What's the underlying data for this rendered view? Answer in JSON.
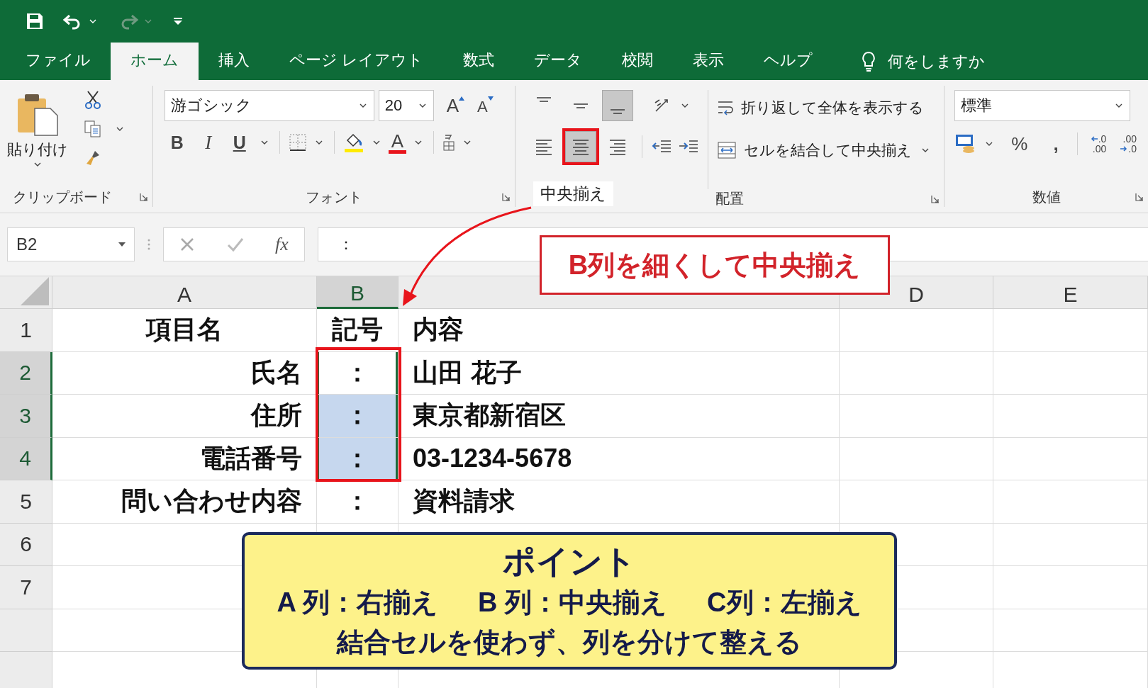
{
  "quick_access": [
    {
      "kind": "save",
      "disabled": false
    },
    {
      "kind": "undo",
      "disabled": false
    },
    {
      "kind": "redo",
      "disabled": true
    },
    {
      "kind": "customize",
      "disabled": false
    }
  ],
  "tabs": [
    {
      "label": "ファイル",
      "selected": false
    },
    {
      "label": "ホーム",
      "selected": true
    },
    {
      "label": "挿入",
      "selected": false
    },
    {
      "label": "ページ レイアウト",
      "selected": false
    },
    {
      "label": "数式",
      "selected": false
    },
    {
      "label": "データ",
      "selected": false
    },
    {
      "label": "校閲",
      "selected": false
    },
    {
      "label": "表示",
      "selected": false
    },
    {
      "label": "ヘルプ",
      "selected": false
    }
  ],
  "tell_me": "何をしますか",
  "clipboard": {
    "paste_label": "貼り付け",
    "title": "クリップボード"
  },
  "font": {
    "font_name": "游ゴシック",
    "font_size": "20",
    "grow_letter": "A",
    "shrink_letter": "A",
    "style_buttons": [
      "B",
      "I",
      "U"
    ],
    "font_color_letter": "A",
    "title": "フォント"
  },
  "alignment": {
    "buttons": [
      {
        "kind": "top",
        "selected": false,
        "annotated": false
      },
      {
        "kind": "middle",
        "selected": false,
        "annotated": false
      },
      {
        "kind": "bottom",
        "selected": true,
        "annotated": false
      },
      {
        "kind": "left",
        "selected": false,
        "annotated": false
      },
      {
        "kind": "center",
        "selected": true,
        "annotated": true
      },
      {
        "kind": "right",
        "selected": false,
        "annotated": false
      }
    ],
    "wrap_text": "折り返して全体を表示する",
    "merge_center": "セルを結合して中央揃え",
    "title": "配置"
  },
  "number": {
    "format": "標準",
    "percent": "%",
    "comma": ",",
    "increase_decimal": {
      "top": ".0",
      "bottom": ".00"
    },
    "decrease_decimal": {
      "top": ".00",
      "bottom": ".0"
    },
    "title": "数値"
  },
  "formula_bar": {
    "name_box": "B2",
    "fx": "fx",
    "content": "："
  },
  "sheet": {
    "columns": [
      {
        "label": "A",
        "selected": false
      },
      {
        "label": "B",
        "selected": true
      },
      {
        "selected": false
      },
      {
        "label": "D",
        "selected": false
      },
      {
        "label": "E",
        "selected": false
      }
    ],
    "rows": [
      {
        "number": "1",
        "selected": false,
        "cells": [
          {
            "text": "項目名",
            "selected": false
          },
          {
            "text": "記号",
            "selected": false
          },
          {
            "text": "内容",
            "selected": false
          }
        ]
      },
      {
        "number": "2",
        "selected": true,
        "cells": [
          {
            "text": "氏名",
            "selected": false
          },
          {
            "text": "：",
            "selected": true,
            "active": true
          },
          {
            "text": "山田 花子",
            "selected": false
          }
        ]
      },
      {
        "number": "3",
        "selected": true,
        "cells": [
          {
            "text": "住所",
            "selected": false
          },
          {
            "text": "：",
            "selected": true
          },
          {
            "text": "東京都新宿区",
            "selected": false
          }
        ]
      },
      {
        "number": "4",
        "selected": true,
        "cells": [
          {
            "text": "電話番号",
            "selected": false
          },
          {
            "text": "：",
            "selected": true
          },
          {
            "text": "03-1234-5678",
            "selected": false
          }
        ]
      },
      {
        "number": "5",
        "selected": false,
        "cells": [
          {
            "text": "問い合わせ内容",
            "selected": false
          },
          {
            "text": "：",
            "selected": false
          },
          {
            "text": "資料請求",
            "selected": false
          }
        ]
      },
      {
        "number": "6",
        "selected": false,
        "cells": []
      },
      {
        "number": "7",
        "selected": false,
        "cells": []
      },
      {
        "selected": false,
        "cells": []
      },
      {
        "selected": false,
        "cells": []
      }
    ]
  },
  "annotations": {
    "button_label": "中央揃え",
    "callout": "B列を細くして中央揃え",
    "point": {
      "title": "ポイント",
      "rules": [
        "A 列：右揃え",
        "B 列：中央揃え",
        "C列：左揃え"
      ],
      "note": "結合セルを使わず、列を分けて整える"
    }
  }
}
